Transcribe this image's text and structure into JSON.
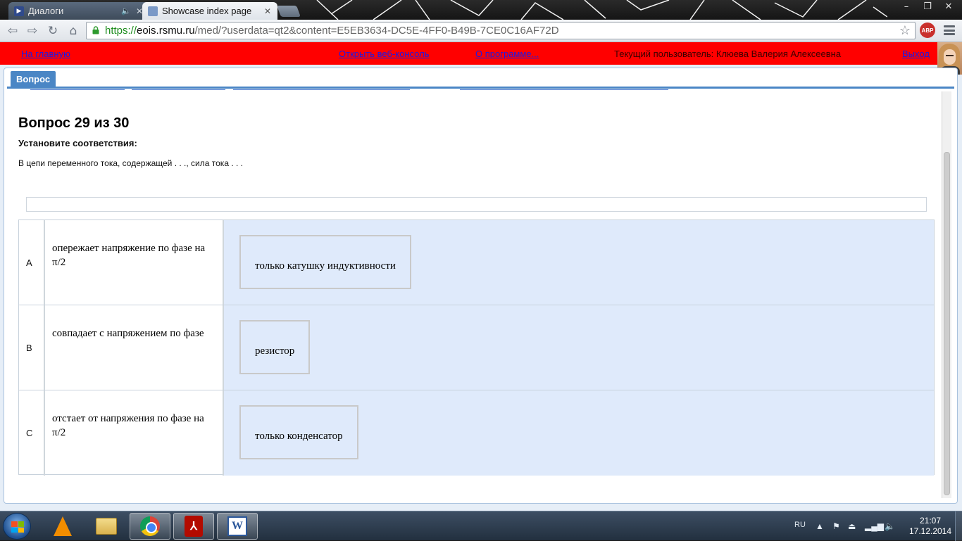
{
  "browser": {
    "tabs": [
      {
        "label": "Диалоги",
        "active": false
      },
      {
        "label": "Showcase index page",
        "active": true
      }
    ],
    "url": {
      "scheme": "https://",
      "host": "eois.rsmu.ru",
      "rest": "/med/?userdata=qt2&content=E5EB3634-DC5E-4FF0-B49B-7CE0C16AF72D"
    },
    "extension_label": "ABP"
  },
  "site_header": {
    "home_link": "На главную",
    "console_link": "Открыть веб-консоль",
    "about_link": "О программе...",
    "current_user": "Текущий пользователь: Клюева Валерия Алексеевна",
    "logout_link": "Выход"
  },
  "panel": {
    "tab_label": "Вопрос"
  },
  "question": {
    "title": "Вопрос 29 из 30",
    "instruction": "Установите соответствия:",
    "text": "В цепи переменного тока, содержащей . . ., сила тока . . ."
  },
  "matches": [
    {
      "letter": "A",
      "prompt": "опережает напряжение по фазе на π/2",
      "answer": "только катушку индуктивности"
    },
    {
      "letter": "B",
      "prompt": "совпадает с напряжением по фазе",
      "answer": "резистор"
    },
    {
      "letter": "C",
      "prompt": "отстает от напряжения по фазе на π/2",
      "answer": "только конденсатор"
    }
  ],
  "taskbar": {
    "language": "RU",
    "time": "21:07",
    "date": "17.12.2014"
  },
  "colors": {
    "header_red": "#ff0000",
    "link_blue": "#1a1ae6",
    "panel_blue": "#4a86c5",
    "drop_zone": "#dfeafb"
  }
}
